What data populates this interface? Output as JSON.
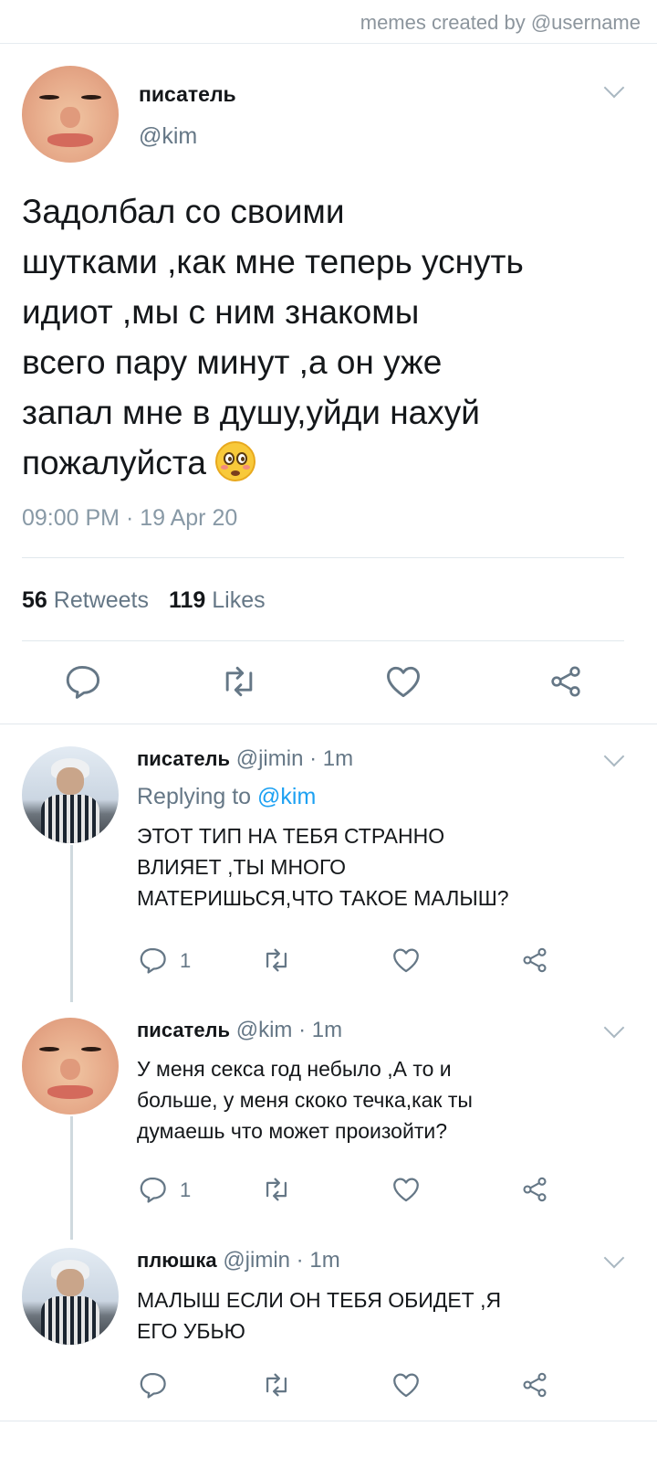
{
  "watermark": "memes created by @username",
  "main_tweet": {
    "name": "писатель",
    "handle": "@kim",
    "text_lines": [
      "Задолбал со своими",
      "шутками ,как мне теперь уснуть",
      "идиот ,мы с ним знакомы",
      "всего пару минут ,а он уже",
      "запал мне в душу,уйди нахуй",
      "пожалуйста"
    ],
    "timestamp": "09:00 PM · 19 Apr 20",
    "retweets_count": "56",
    "retweets_label": "Retweets",
    "likes_count": "119",
    "likes_label": "Likes"
  },
  "replies": [
    {
      "name": "писатель",
      "meta": "@jimin · 1m",
      "replying_prefix": "Replying to",
      "replying_handle": "@kim",
      "text_lines": [
        "ЭТОТ ТИП НА ТЕБЯ СТРАННО",
        "ВЛИЯЕТ ,ТЫ МНОГО",
        "МАТЕРИШЬСЯ,ЧТО ТАКОЕ МАЛЫШ?"
      ],
      "reply_count": "1"
    },
    {
      "name": "писатель",
      "meta": "@kim · 1m",
      "text_lines": [
        "У меня секса год небыло ,А то и",
        "больше, у меня скоко течка,как ты",
        "думаешь что может произойти?"
      ],
      "reply_count": "1"
    },
    {
      "name": "плюшка",
      "meta": "@jimin · 1m",
      "text_lines": [
        "МАЛЫШ ЕСЛИ ОН ТЕБЯ ОБИДЕТ ,Я",
        "ЕГО УБЬЮ"
      ],
      "reply_count": ""
    }
  ],
  "icons": {
    "reply": "reply-icon",
    "retweet": "retweet-icon",
    "like": "like-icon",
    "share": "share-icon",
    "caret": "chevron-down-icon",
    "emoji": "flushed-face-emoji"
  },
  "colors": {
    "link": "#1da1f2",
    "muted": "#657786",
    "text": "#14171a"
  }
}
